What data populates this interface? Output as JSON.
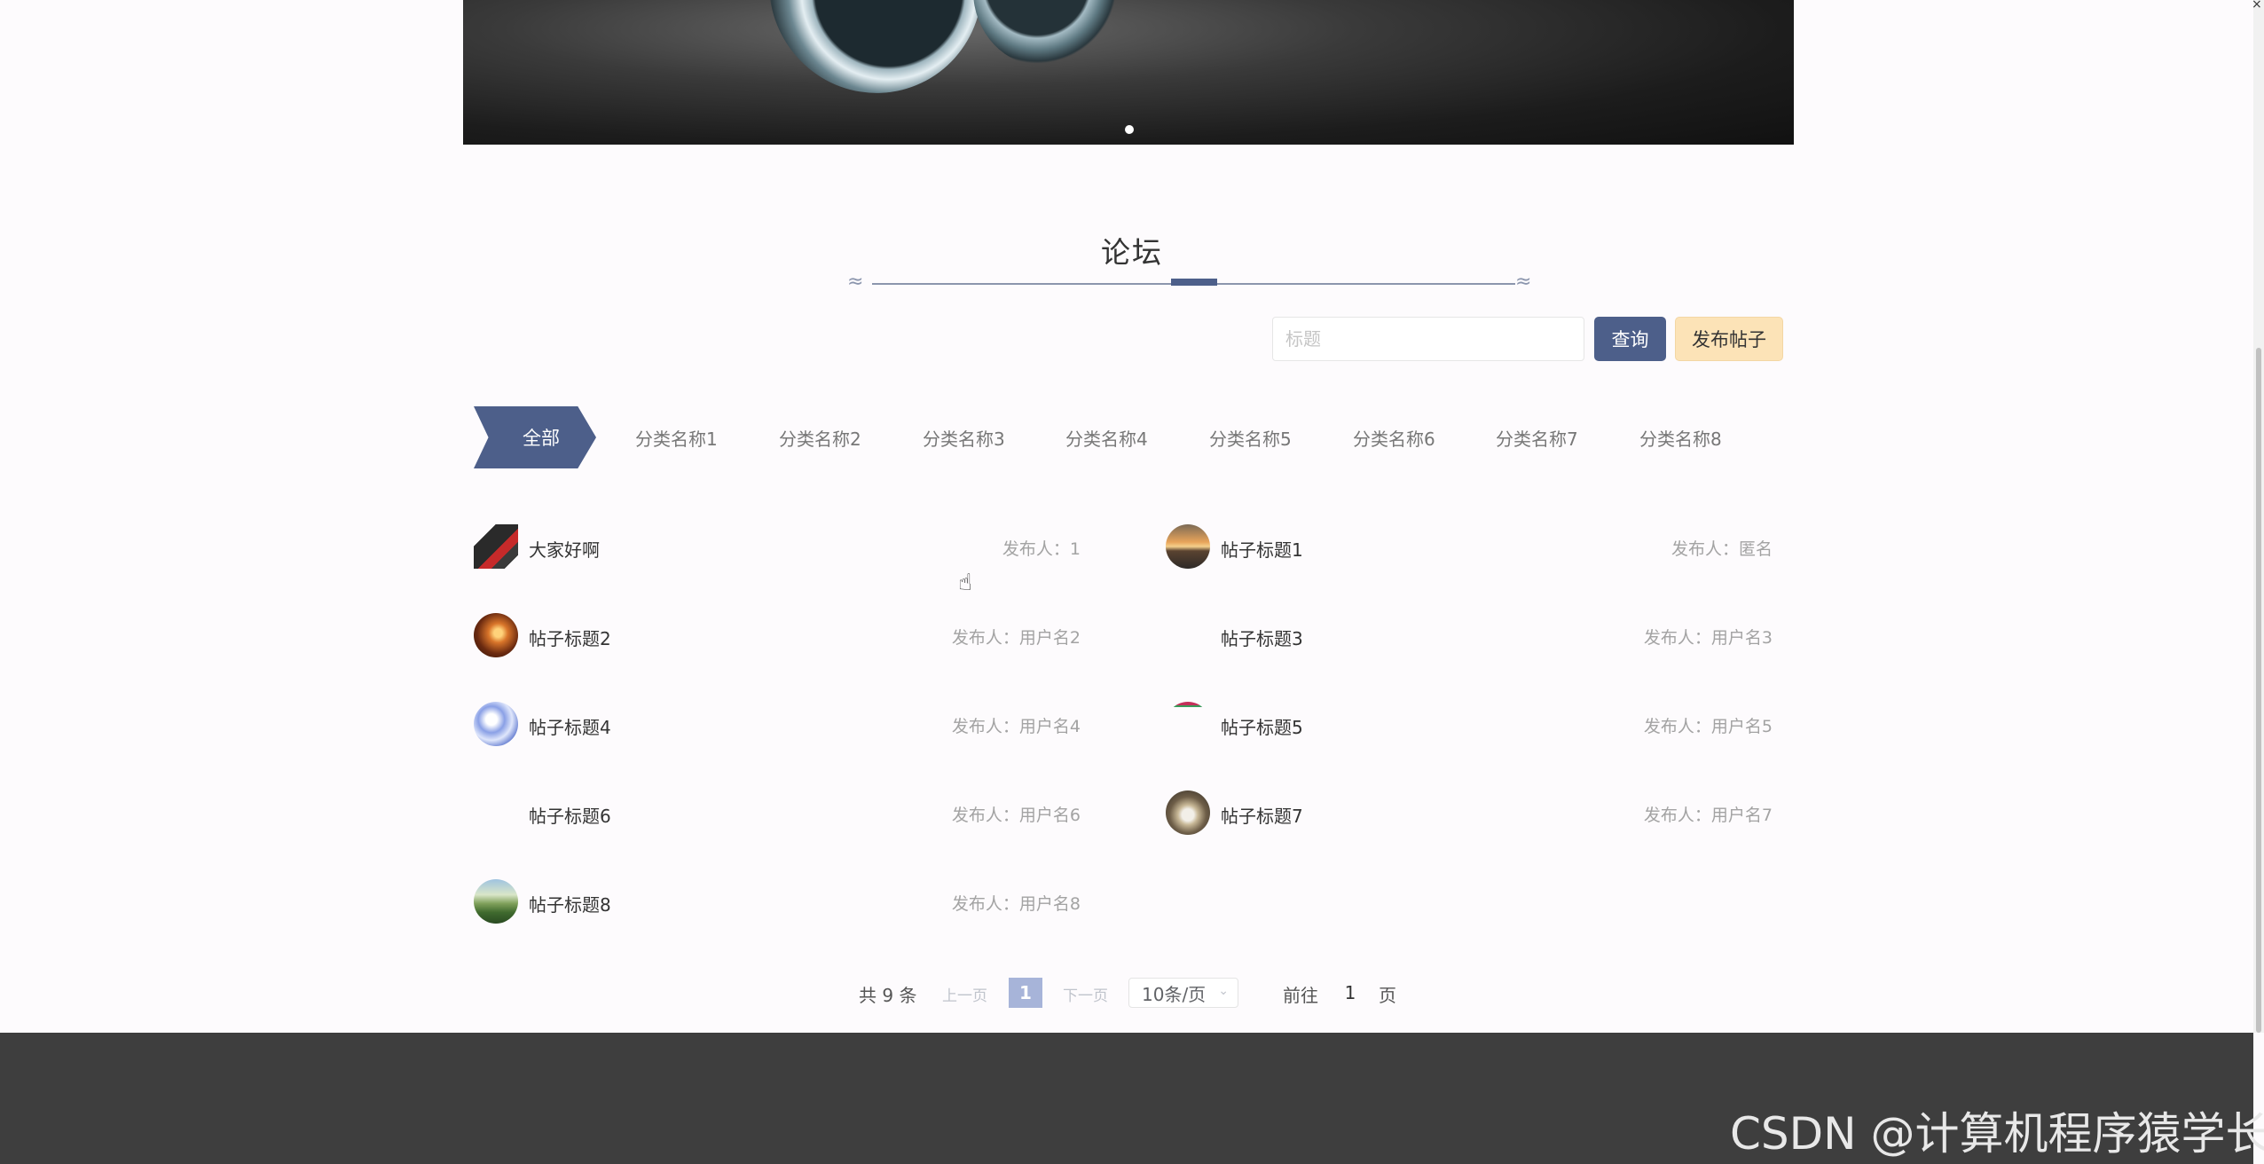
{
  "banner": {
    "image": "smartwatch-product",
    "dots": 1
  },
  "section": {
    "title": "论坛"
  },
  "search": {
    "placeholder": "标题",
    "query_label": "查询",
    "post_label": "发布帖子"
  },
  "categories": {
    "active": "全部",
    "items": [
      "分类名称1",
      "分类名称2",
      "分类名称3",
      "分类名称4",
      "分类名称5",
      "分类名称6",
      "分类名称7",
      "分类名称8"
    ]
  },
  "posts": [
    {
      "title": "大家好啊",
      "author_label": "发布人：",
      "author": "1",
      "avatar": "laptop"
    },
    {
      "title": "帖子标题1",
      "author_label": "发布人：",
      "author": "匿名",
      "avatar": "sunset-sea"
    },
    {
      "title": "帖子标题2",
      "author_label": "发布人：",
      "author": "用户名2",
      "avatar": "sunset-tree"
    },
    {
      "title": "帖子标题3",
      "author_label": "发布人：",
      "author": "用户名3",
      "avatar": "blank"
    },
    {
      "title": "帖子标题4",
      "author_label": "发布人：",
      "author": "用户名4",
      "avatar": "blue-abstract"
    },
    {
      "title": "帖子标题5",
      "author_label": "发布人：",
      "author": "用户名5",
      "avatar": "colorful"
    },
    {
      "title": "帖子标题6",
      "author_label": "发布人：",
      "author": "用户名6",
      "avatar": "blank"
    },
    {
      "title": "帖子标题7",
      "author_label": "发布人：",
      "author": "用户名7",
      "avatar": "horse"
    },
    {
      "title": "帖子标题8",
      "author_label": "发布人：",
      "author": "用户名8",
      "avatar": "landscape"
    }
  ],
  "pagination": {
    "total": "共 9 条",
    "prev": "上一页",
    "current": "1",
    "next": "下一页",
    "page_size": "10条/页",
    "goto_label": "前往",
    "goto_value": "1",
    "page_word": "页"
  },
  "watermark": "CSDN @计算机程序猿学长",
  "colors": {
    "primary": "#4d5f8a",
    "post_button": "#fce3b7",
    "footer": "#3e3e3e"
  }
}
